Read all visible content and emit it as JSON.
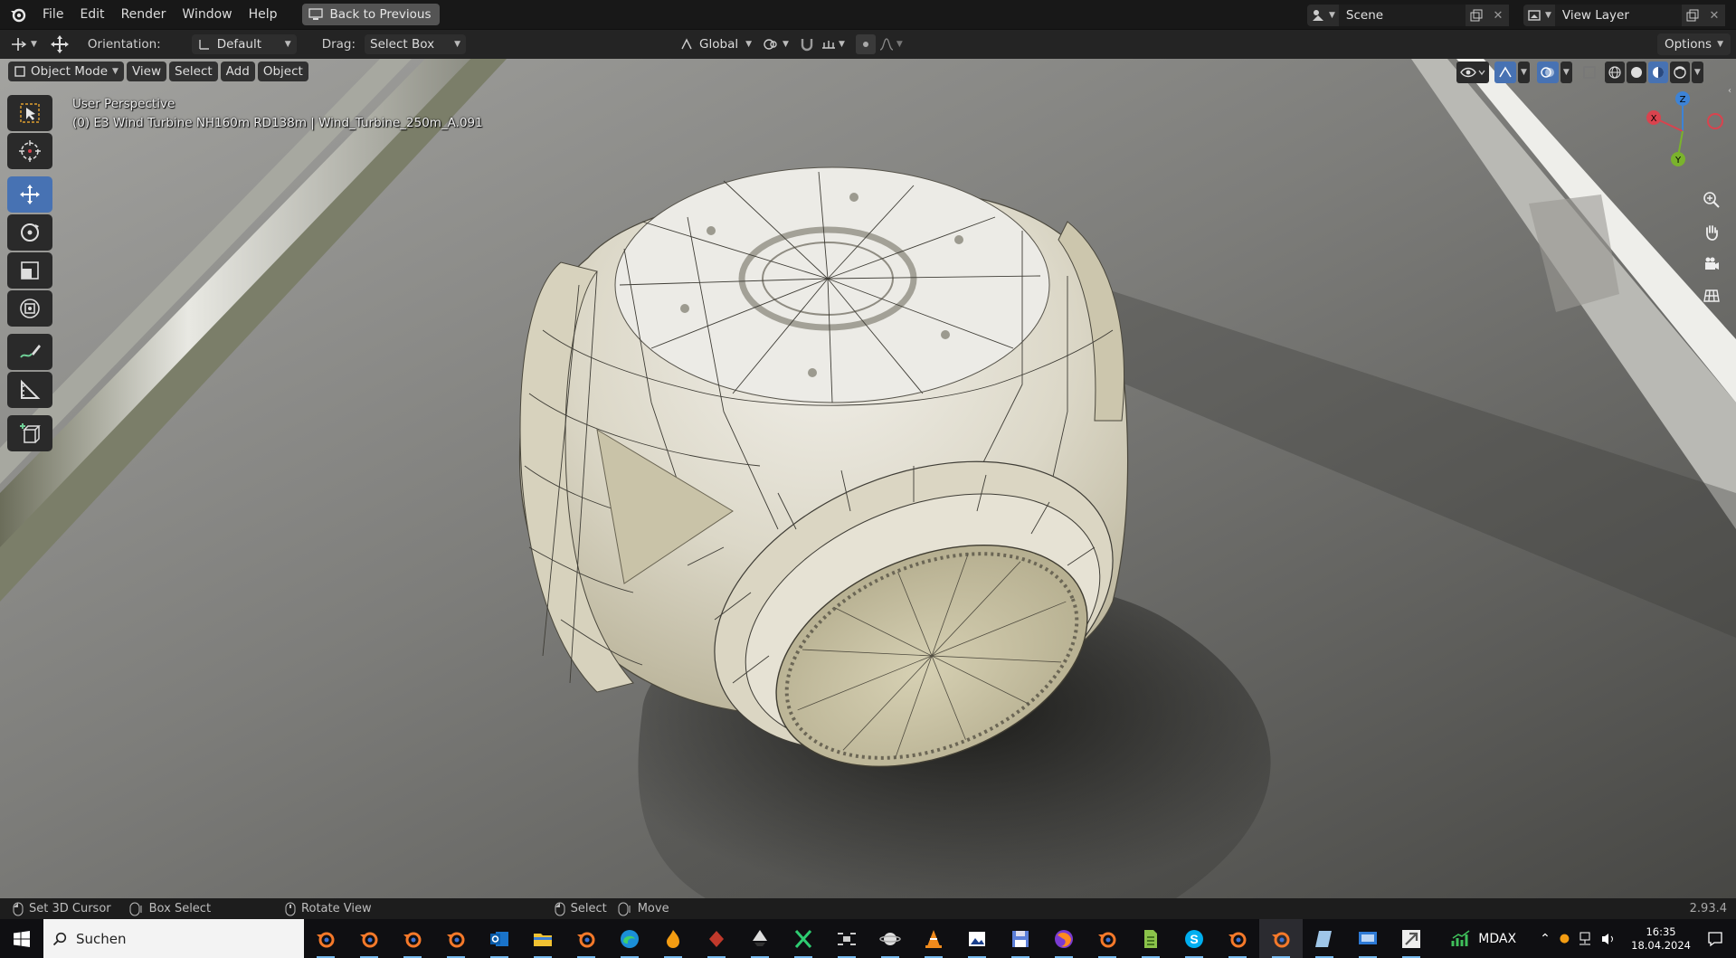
{
  "menubar": {
    "items": [
      "File",
      "Edit",
      "Render",
      "Window",
      "Help"
    ],
    "back_button": "Back to Previous",
    "scene_name": "Scene",
    "view_layer": "View Layer"
  },
  "header": {
    "orientation_label": "Orientation:",
    "orientation_value": "Default",
    "drag_label": "Drag:",
    "drag_value": "Select Box",
    "transform_space": "Global",
    "options": "Options"
  },
  "viewport": {
    "mode": "Object Mode",
    "menus": [
      "View",
      "Select",
      "Add",
      "Object"
    ],
    "perspective": "User Perspective",
    "object_info": "(0) E3 Wind Turbine NH160m RD138m | Wind_Turbine_250m_A.091",
    "gizmo": {
      "x": "X",
      "y": "Y",
      "z": "Z"
    }
  },
  "statusbar": {
    "set_cursor": "Set 3D Cursor",
    "box_select": "Box Select",
    "rotate_view": "Rotate View",
    "select": "Select",
    "move": "Move",
    "version": "2.93.4"
  },
  "taskbar": {
    "search_placeholder": "Suchen",
    "ticker": "MDAX",
    "time": "16:35",
    "date": "18.04.2024"
  },
  "colors": {
    "accent": "#4772b3",
    "axis_x": "#d9434e",
    "axis_y": "#7ab32c",
    "axis_z": "#3d83d6"
  }
}
